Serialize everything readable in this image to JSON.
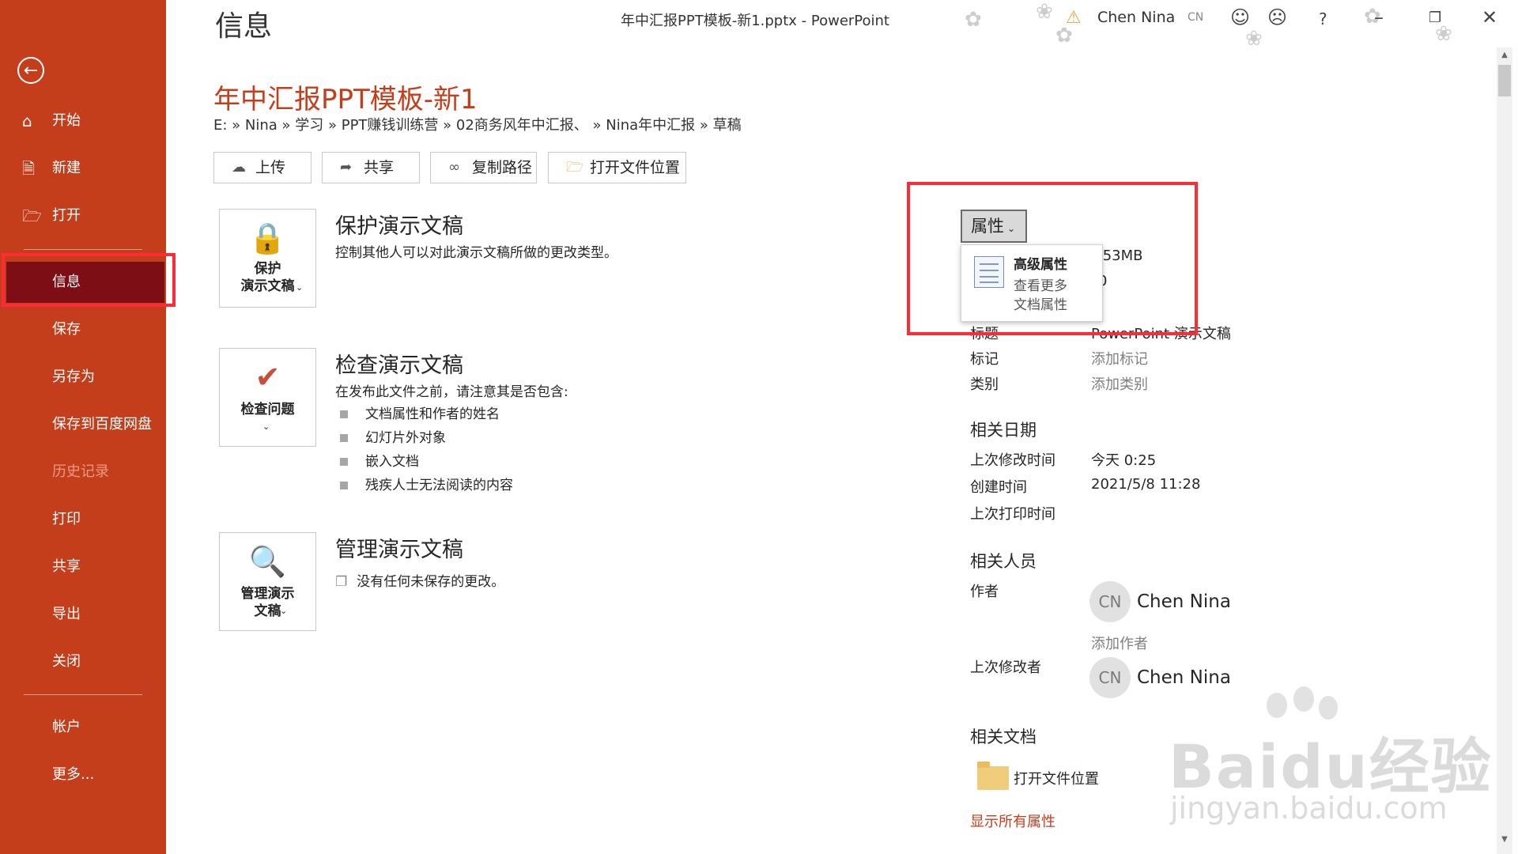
{
  "window": {
    "title": "年中汇报PPT模板-新1.pptx  -  PowerPoint",
    "user": "Chen Nina",
    "user_initials": "CN",
    "help": "?"
  },
  "sidebar": {
    "back_icon": "back-arrow-icon",
    "items": [
      {
        "label": "开始",
        "icon": "home-icon"
      },
      {
        "label": "新建",
        "icon": "new-doc-icon"
      },
      {
        "label": "打开",
        "icon": "open-folder-icon"
      },
      {
        "label": "信息",
        "active": true
      },
      {
        "label": "保存"
      },
      {
        "label": "另存为"
      },
      {
        "label": "保存到百度网盘"
      },
      {
        "label": "历史记录",
        "disabled": true
      },
      {
        "label": "打印"
      },
      {
        "label": "共享"
      },
      {
        "label": "导出"
      },
      {
        "label": "关闭"
      },
      {
        "label": "帐户"
      },
      {
        "label": "更多..."
      }
    ]
  },
  "main": {
    "heading_cut": "信息",
    "doc_title": "年中汇报PPT模板-新1",
    "breadcrumb": "E: » Nina » 学习 » PPT赚钱训练营 » 02商务风年中汇报、 » Nina年中汇报 » 草稿",
    "buttons": [
      {
        "label": "上传",
        "icon": "upload-icon"
      },
      {
        "label": "共享",
        "icon": "share-icon"
      },
      {
        "label": "复制路径",
        "icon": "link-icon"
      },
      {
        "label": "打开文件位置",
        "icon": "folder-icon"
      }
    ],
    "protect": {
      "icon_label": "保护\n演示文稿",
      "title": "保护演示文稿",
      "desc": "控制其他人可以对此演示文稿所做的更改类型。"
    },
    "inspect": {
      "icon_label": "检查问题",
      "title": "检查演示文稿",
      "desc": "在发布此文件之前，请注意其是否包含:",
      "bullets": [
        "文档属性和作者的姓名",
        "幻灯片外对象",
        "嵌入文档",
        "残疾人士无法阅读的内容"
      ]
    },
    "manage": {
      "icon_label": "管理演示\n文稿",
      "title": "管理演示文稿",
      "desc": "没有任何未保存的更改。"
    }
  },
  "properties": {
    "button_label": "属性",
    "menu": {
      "title": "高级属性",
      "desc_line1": "查看更多",
      "desc_line2": "文档属性"
    },
    "size_partial": ".53MB",
    "pages_partial": "0",
    "rows": [
      {
        "label": "标题",
        "value": "PowerPoint 演示文稿"
      },
      {
        "label": "标记",
        "value": "添加标记"
      },
      {
        "label": "类别",
        "value": "添加类别"
      }
    ],
    "dates_heading": "相关日期",
    "dates": [
      {
        "label": "上次修改时间",
        "value": "今天 0:25"
      },
      {
        "label": "创建时间",
        "value": "2021/5/8 11:28"
      },
      {
        "label": "上次打印时间",
        "value": ""
      }
    ],
    "people_heading": "相关人员",
    "author_label": "作者",
    "author": "Chen Nina",
    "add_author": "添加作者",
    "last_modified_by_label": "上次修改者",
    "last_modified_by": "Chen Nina",
    "docs_heading": "相关文档",
    "open_location": "打开文件位置",
    "show_all": "显示所有属性"
  },
  "watermark": {
    "text": "Baidu经验",
    "sub": "jingyan.baidu.com"
  }
}
